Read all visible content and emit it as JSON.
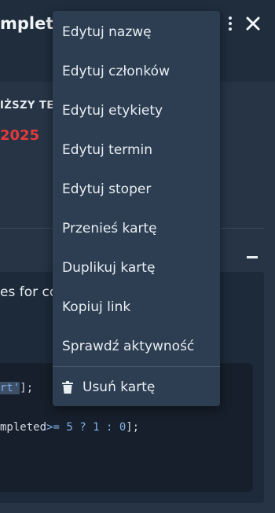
{
  "card": {
    "title": "mplet",
    "section_label": "IŻSZY TE",
    "due_date": "2025",
    "description_snippet": "es for co",
    "code": {
      "line1": {
        "pre": "",
        "hl_str": "rt'",
        "post": "];"
      },
      "line2": {
        "pre": "mpleted",
        "ge": ">=",
        "n5": "5",
        "q": "?",
        "n1": "1",
        "colon": ":",
        "n0": "0",
        "post": "];"
      }
    }
  },
  "menu": {
    "items": [
      {
        "label": "Edytuj nazwę"
      },
      {
        "label": "Edytuj członków"
      },
      {
        "label": "Edytuj etykiety"
      },
      {
        "label": "Edytuj termin"
      },
      {
        "label": "Edytuj stoper"
      },
      {
        "label": "Przenieś kartę"
      },
      {
        "label": "Duplikuj kartę"
      },
      {
        "label": "Kopiuj link"
      },
      {
        "label": "Sprawdź aktywność"
      }
    ],
    "delete_label": "Usuń kartę"
  },
  "icons": {
    "kebab": "kebab-menu-icon",
    "close": "close-icon",
    "collapse": "minus-icon",
    "trash": "trash-icon"
  },
  "colors": {
    "menu_bg": "#2d3e52",
    "header_bg": "#1f2d3d",
    "due_date_red": "#e5393a"
  }
}
